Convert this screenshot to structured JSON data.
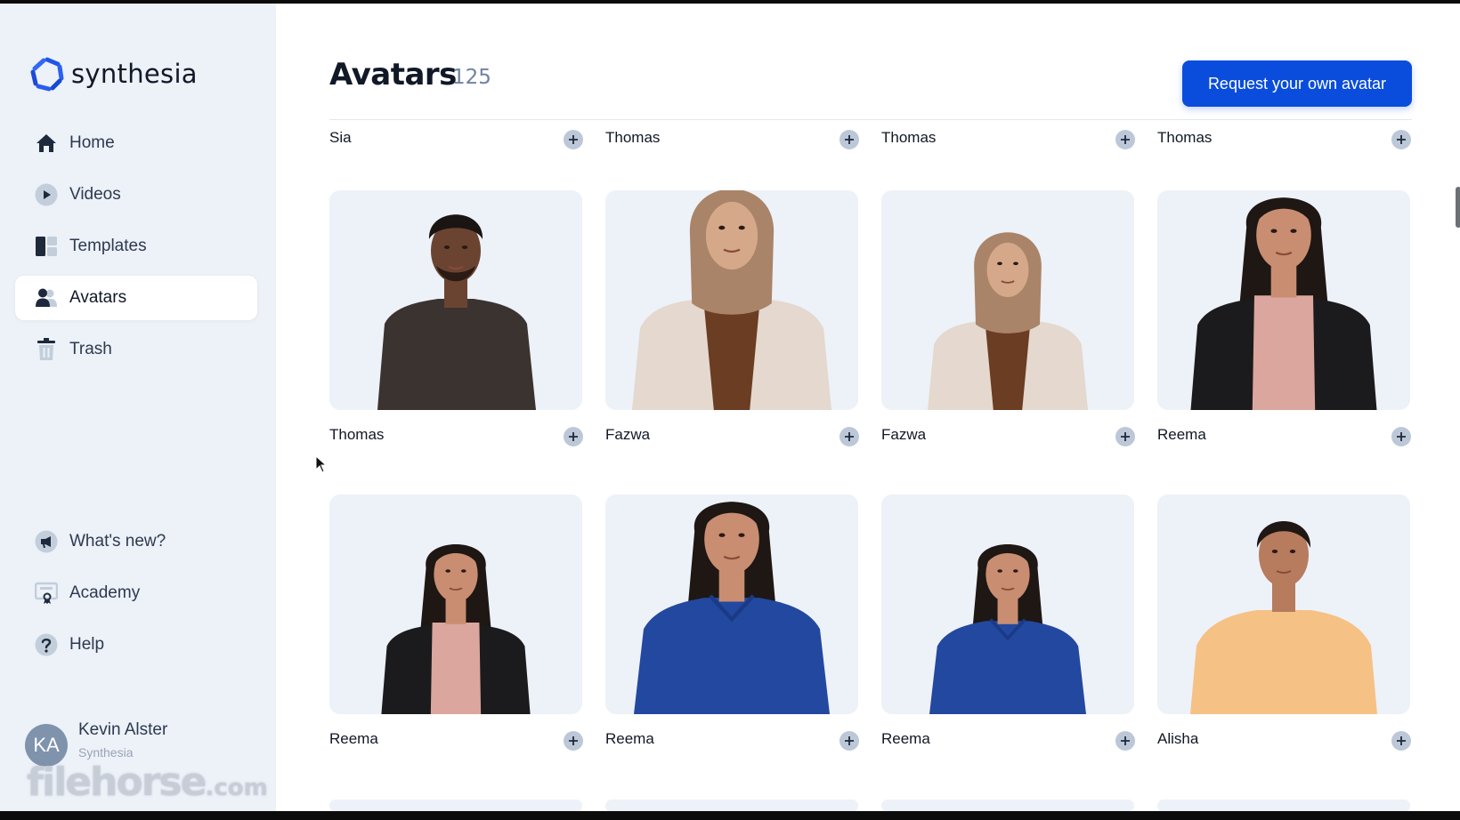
{
  "app": {
    "brand": "synthesia"
  },
  "sidebar": {
    "nav": [
      {
        "label": "Home",
        "icon": "home-icon"
      },
      {
        "label": "Videos",
        "icon": "play-icon"
      },
      {
        "label": "Templates",
        "icon": "templates-icon"
      },
      {
        "label": "Avatars",
        "icon": "avatars-icon",
        "active": true
      },
      {
        "label": "Trash",
        "icon": "trash-icon"
      }
    ],
    "secondary": [
      {
        "label": "What's new?",
        "icon": "megaphone-icon"
      },
      {
        "label": "Academy",
        "icon": "academy-certificate-icon"
      },
      {
        "label": "Help",
        "icon": "help-icon"
      }
    ],
    "user": {
      "initials": "KA",
      "name": "Kevin Alster",
      "org": "Synthesia"
    }
  },
  "watermark": {
    "text": "filehorse",
    "suffix": ".com"
  },
  "main": {
    "title": "Avatars",
    "count": "125",
    "request_button": "Request your own avatar",
    "top_row": [
      "Sia",
      "Thomas",
      "Thomas",
      "Thomas"
    ],
    "avatars": [
      {
        "name": "Thomas",
        "look": "man-dark-sweater"
      },
      {
        "name": "Fazwa",
        "look": "hijab-close"
      },
      {
        "name": "Fazwa",
        "look": "hijab-wide"
      },
      {
        "name": "Reema",
        "look": "blazer-pink-close"
      },
      {
        "name": "Reema",
        "look": "blazer-pink-wide"
      },
      {
        "name": "Reema",
        "look": "blue-polo-close"
      },
      {
        "name": "Reema",
        "look": "blue-polo-wide"
      },
      {
        "name": "Alisha",
        "look": "orange-sweater"
      }
    ]
  },
  "colors": {
    "accent": "#0a4ddc",
    "sidebar_bg": "#edf1f8",
    "add_button": "#bcc8d8",
    "count_text": "#6f83a0"
  }
}
